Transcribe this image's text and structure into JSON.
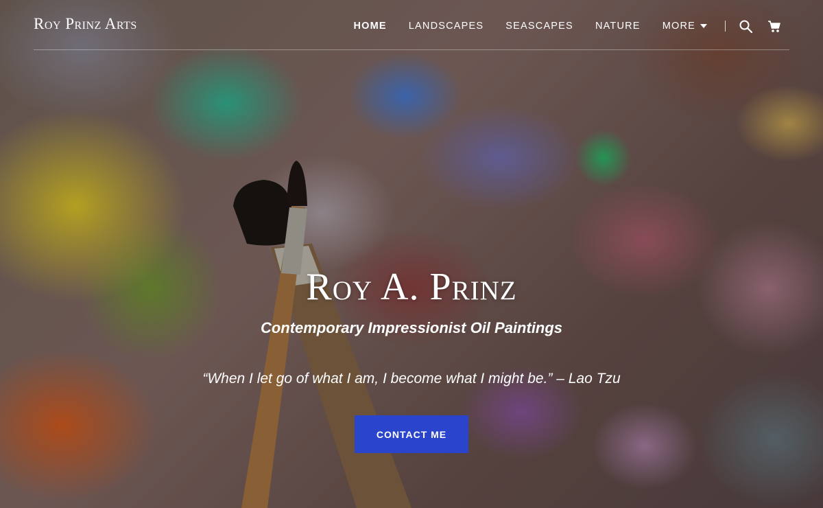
{
  "header": {
    "site_title": "Roy Prinz Arts",
    "nav": [
      {
        "label": "HOME",
        "active": true
      },
      {
        "label": "LANDSCAPES"
      },
      {
        "label": "SEASCAPES"
      },
      {
        "label": "NATURE"
      },
      {
        "label": "MORE",
        "dropdown": true
      }
    ],
    "icons": [
      "search-icon",
      "cart-icon"
    ]
  },
  "hero": {
    "title": "Roy A. Prinz",
    "subtitle": "Contemporary Impressionist Oil Paintings",
    "quote": "“When I let go of what I am, I become what I might be.” – Lao Tzu",
    "cta_label": "CONTACT ME"
  },
  "colors": {
    "cta_background": "#2b44cc",
    "text": "#ffffff"
  }
}
